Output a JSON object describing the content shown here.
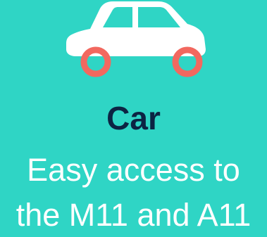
{
  "icon": "car-icon",
  "colors": {
    "background": "#2fd5c5",
    "title": "#0c2443",
    "text": "#ffffff",
    "car_body": "#ffffff",
    "wheel": "#f2685f"
  },
  "title": "Car",
  "description": {
    "line1": "Easy access to",
    "line2": "the M11 and A11"
  }
}
